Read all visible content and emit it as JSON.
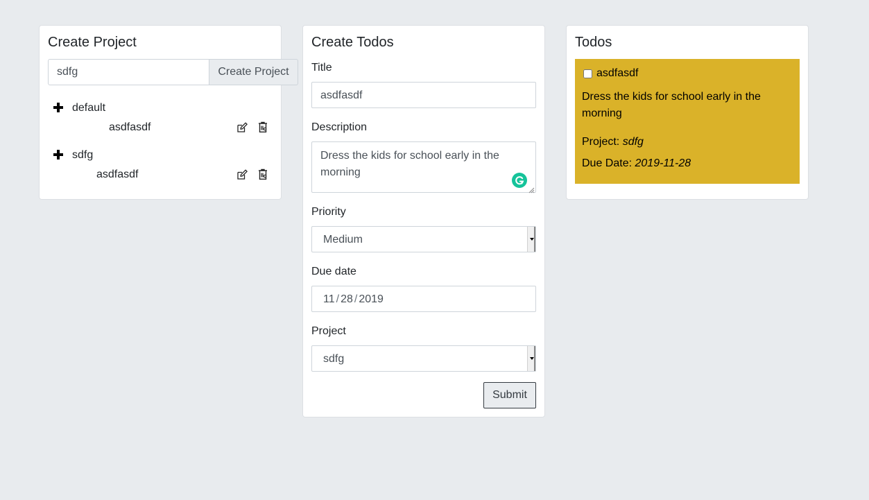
{
  "create_project": {
    "title": "Create Project",
    "input_value": "sdfg",
    "button_label": "Create Project",
    "projects": [
      {
        "name": "default",
        "todos": [
          "asdfasdf"
        ]
      },
      {
        "name": "sdfg",
        "todos": [
          "asdfasdf"
        ]
      }
    ],
    "icons": {
      "expand": "plus-icon",
      "edit": "edit-icon",
      "delete": "trash-icon"
    }
  },
  "create_todos": {
    "title": "Create Todos",
    "title_label": "Title",
    "title_value": "asdfasdf",
    "description_label": "Description",
    "description_value": "Dress the kids for school early in the morning",
    "priority_label": "Priority",
    "priority_value": "Medium",
    "due_date_label": "Due date",
    "due_date": {
      "month": "11",
      "day": "28",
      "year": "2019"
    },
    "project_label": "Project",
    "project_value": "sdfg",
    "submit_label": "Submit"
  },
  "todos": {
    "title": "Todos",
    "items": [
      {
        "title": "asdfasdf",
        "description": "Dress the kids for school early in the morning",
        "project_label": "Project:",
        "project": "sdfg",
        "due_label": "Due Date:",
        "due_date": "2019-11-28",
        "checked": false,
        "color": "#dab229"
      }
    ]
  },
  "colors": {
    "background": "#e8ebee",
    "card": "#ffffff",
    "todo_priority_medium": "#dab229",
    "grammarly": "#15c39a"
  }
}
